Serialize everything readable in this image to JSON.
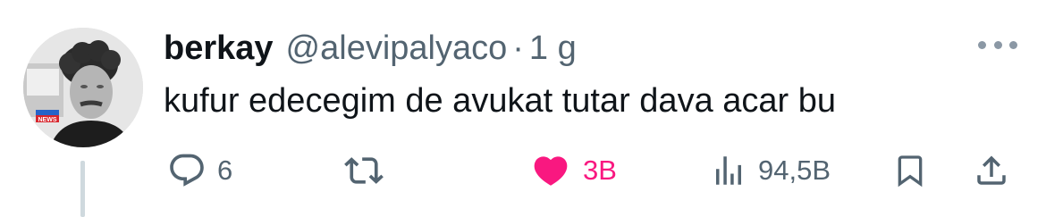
{
  "tweet": {
    "author": {
      "display_name": "berkay",
      "handle": "@alevipalyaco",
      "separator": "·",
      "time": "1 g",
      "avatar_badge": "NEWS"
    },
    "text": "kufur edecegim de avukat tutar dava acar bu",
    "actions": {
      "reply_count": "6",
      "retweet_count": "",
      "like_count": "3B",
      "views_count": "94,5B"
    },
    "colors": {
      "like": "#f91880",
      "muted": "#536471",
      "text": "#0f1419"
    },
    "icons": [
      "more-icon",
      "reply-icon",
      "retweet-icon",
      "heart-icon",
      "views-icon",
      "bookmark-icon",
      "share-icon"
    ]
  }
}
